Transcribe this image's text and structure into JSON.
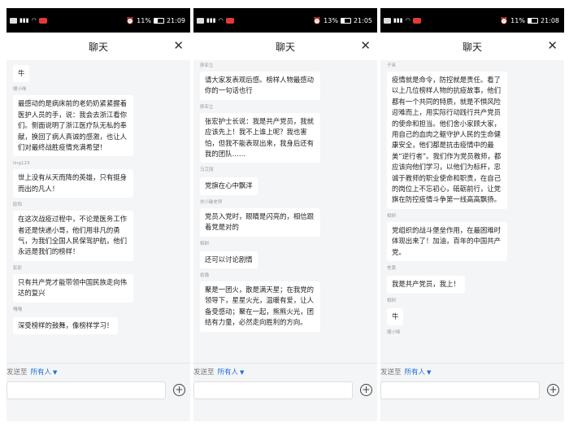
{
  "phones": [
    {
      "status": {
        "battery": "11%",
        "time": "21:09"
      },
      "title": "聊天",
      "messages": [
        {
          "sender": "",
          "text": "牛"
        },
        {
          "sender": "顺小咪",
          "text": "最感动的是病床前的老奶奶紧紧握着医护人员的手，说：我会去浙江看你们。侧面说明了浙江医疗队无私的奉献，换回了病人真诚的感激，也让人们对最终战胜疫情充满希望！"
        },
        {
          "sender": "ling123",
          "text": "世上没有从天而降的英雄，只有挺身而出的凡人！"
        },
        {
          "sender": "欧阳",
          "text": "在这次战疫过程中，不论是医务工作者还是快递小哥，他们用非凡的勇气，为我们全国人民保驾护航，他们永远是我们的榜样！"
        },
        {
          "sender": "彭彭",
          "text": "只有共产党才能带领中国民族走向伟达的复兴"
        },
        {
          "sender": "嘎嘎",
          "text": "深受榜样的鼓舞，像榜样学习！"
        }
      ],
      "footer": {
        "send_to": "发送至",
        "target": "所有人"
      }
    },
    {
      "status": {
        "battery": "13%",
        "time": "21:05"
      },
      "title": "聊天",
      "messages": [
        {
          "sender": "廖亚立",
          "text": "请大家发表观后感。榜样人物最感动你的一句话也行"
        },
        {
          "sender": "廖亚立",
          "text": "张宏护士长说：我是共产党员，我就应该先上！我不上谁上呢？我也害怕，但我不能表现出来，我身后还有我的团队……"
        },
        {
          "sender": "马艾丽",
          "text": "党旗在心中飘洋"
        },
        {
          "sender": "刘小敏老师",
          "text": "党员入党时，眼睛是闪亮的，相信跟着党是对的"
        },
        {
          "sender": "相树",
          "text": "还可以讨论剧情"
        },
        {
          "sender": "俞璐",
          "text": "聚是一团火，散是满天星；在我党的领导下，星星火光，温暖有爱，让人备受感动；聚在一起，熊熊火光，团结有力量，必然走向胜利的方向。"
        }
      ],
      "footer": {
        "send_to": "发送至",
        "target": "所有人"
      }
    },
    {
      "status": {
        "battery": "11%",
        "time": "21:08"
      },
      "title": "聊天",
      "messages": [
        {
          "sender": "子英",
          "text": "疫情就是命令，防控就是责任。看了以上几位榜样人物的抗疫故事，他们都有一个共同的特质，就是不惧风险迎难而上，用实际行动践行共产党员的使命和担当。他们舍小家顾大家，用自己的血肉之躯守护人民的生命健康安全，他们都是抗击疫情中的最美“逆行者”。我们作为党员教师，都应该向他们学习，以他们为标杆，忠诚于教师的职业使命和职责，在自己的岗位上不忘初心，砥砺前行，让党旗在防控疫情斗争第一线高高飘扬。"
        },
        {
          "sender": "相树",
          "text": "党组织的战斗堡垒作用，在最困难时体现出来了！加油，百年的中国共产党。"
        },
        {
          "sender": "老黄",
          "text": "我是共产党员，我上！"
        },
        {
          "sender": "相树",
          "text": "牛"
        },
        {
          "sender": "顺小咪",
          "text": ""
        }
      ],
      "footer": {
        "send_to": "发送至",
        "target": "所有人"
      }
    }
  ],
  "colors": {
    "accent": "#1e6fd9",
    "statusbar": "#000000",
    "chat_bg": "#f4f5f7"
  },
  "icons": {
    "close": "close-icon",
    "add": "plus-circle-icon",
    "caret": "caret-down-icon"
  }
}
